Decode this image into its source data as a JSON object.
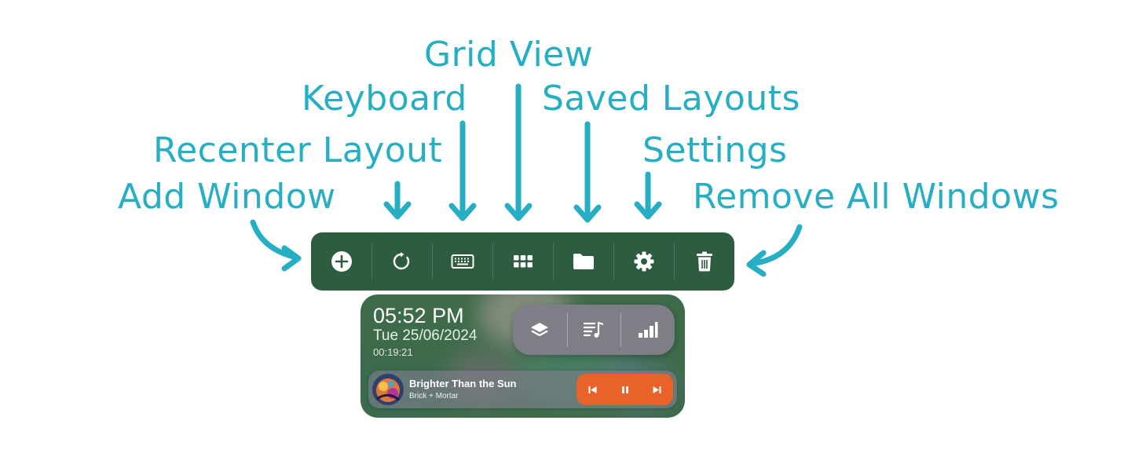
{
  "colors": {
    "annotation": "#26aec4",
    "toolbar_bg": "#2e5c41",
    "icon": "#ffffff",
    "widget_bg": "#3e6b4a",
    "pill_bg": "#7e7f86",
    "controls_bg": "#e8622a"
  },
  "annotations": {
    "grid_view": "Grid View",
    "keyboard": "Keyboard",
    "saved_layouts": "Saved Layouts",
    "recenter_layout": "Recenter Layout",
    "settings": "Settings",
    "add_window": "Add Window",
    "remove_all_windows": "Remove All Windows"
  },
  "toolbar": {
    "buttons": [
      {
        "id": "add-window",
        "icon": "plus-circle-icon"
      },
      {
        "id": "recenter-layout",
        "icon": "rotate-icon"
      },
      {
        "id": "keyboard",
        "icon": "keyboard-icon"
      },
      {
        "id": "grid-view",
        "icon": "grid-icon"
      },
      {
        "id": "saved-layouts",
        "icon": "folder-icon"
      },
      {
        "id": "settings",
        "icon": "gear-icon"
      },
      {
        "id": "remove-all-windows",
        "icon": "trash-icon"
      }
    ]
  },
  "widget": {
    "time": "05:52 PM",
    "date": "Tue 25/06/2024",
    "timer": "00:19:21",
    "quick_buttons": [
      "layers-icon",
      "playlist-icon",
      "signal-bars-icon"
    ],
    "player": {
      "title": "Brighter Than the Sun",
      "artist": "Brick + Mortar",
      "controls": [
        "previous-icon",
        "pause-icon",
        "next-icon"
      ]
    }
  }
}
